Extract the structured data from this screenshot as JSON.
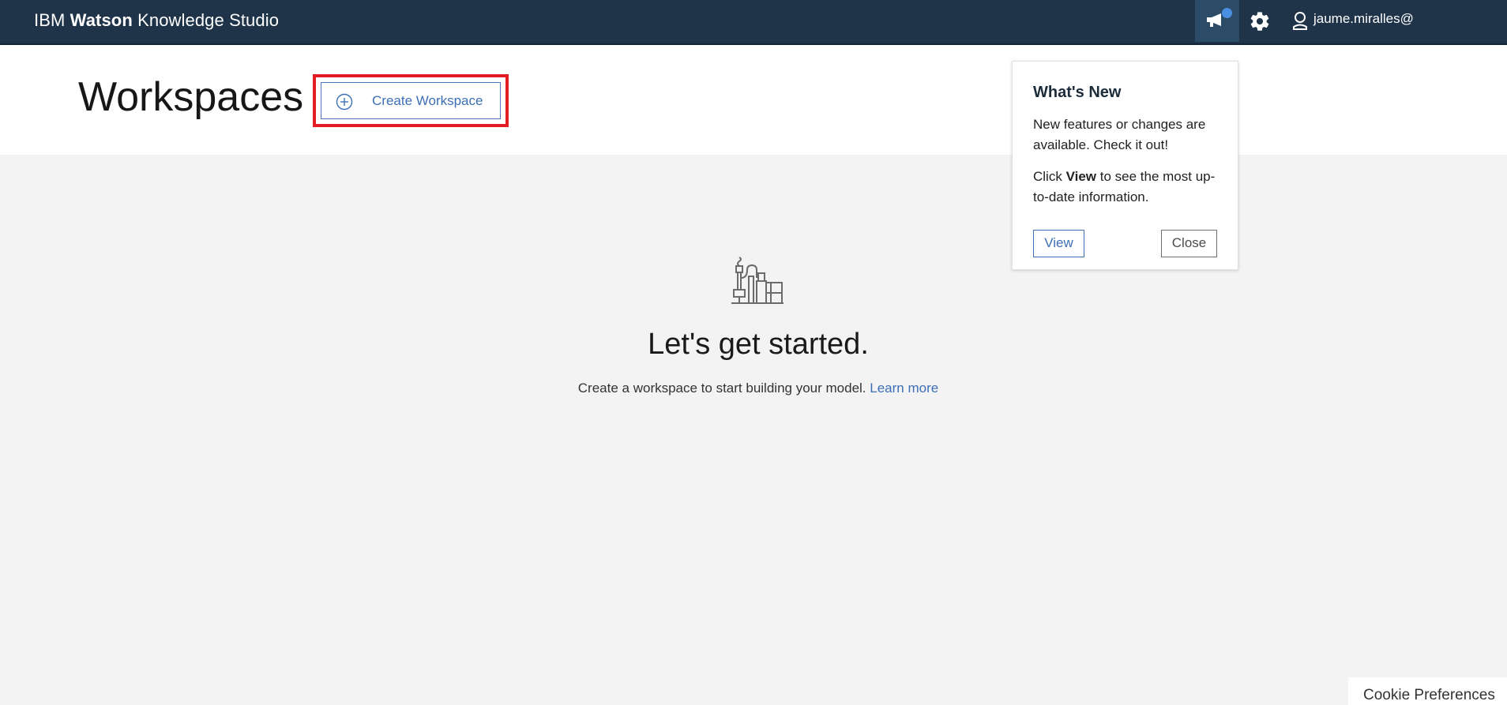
{
  "topbar": {
    "brand_prefix": "IBM",
    "brand_bold": "Watson",
    "brand_suffix": "Knowledge Studio",
    "user_name": "jaume.miralles@"
  },
  "header": {
    "title": "Workspaces",
    "create_label": "Create Workspace"
  },
  "empty_state": {
    "title": "Let's get started.",
    "description": "Create a workspace to start building your model.",
    "link": "Learn more"
  },
  "popover": {
    "title": "What's New",
    "text1": "New features or changes are available. Check it out!",
    "text2_prefix": "Click",
    "text2_bold": "View",
    "text2_suffix": "to see the most up-to-date information.",
    "view_label": "View",
    "close_label": "Close"
  },
  "cookie_label": "Cookie Preferences",
  "colors": {
    "topbar_bg": "#1f3449",
    "accent": "#3d6fb6",
    "highlight": "#e31b23",
    "notification": "#4b8fe2"
  }
}
